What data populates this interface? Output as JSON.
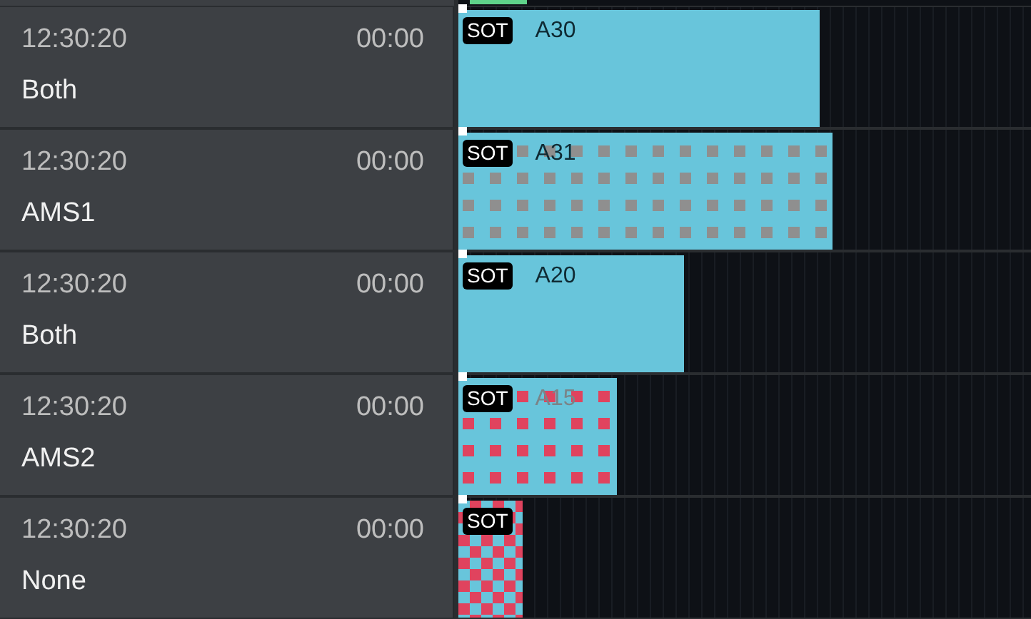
{
  "rows": [
    {
      "time": "12:30:20",
      "duration": "00:00",
      "mode": "Both",
      "clip": {
        "badge": "SOT",
        "label": "A30",
        "kind": "plain",
        "level": 0.63,
        "label_dimmed": false
      }
    },
    {
      "time": "12:30:20",
      "duration": "00:00",
      "mode": "AMS1",
      "clip": {
        "badge": "SOT",
        "label": "A31",
        "kind": "grey-squares",
        "level": 0.653,
        "label_dimmed": false
      }
    },
    {
      "time": "12:30:20",
      "duration": "00:00",
      "mode": "Both",
      "clip": {
        "badge": "SOT",
        "label": "A20",
        "kind": "plain",
        "level": 0.395,
        "label_dimmed": false
      }
    },
    {
      "time": "12:30:20",
      "duration": "00:00",
      "mode": "AMS2",
      "clip": {
        "badge": "SOT",
        "label": "A15",
        "kind": "red-squares",
        "level": 0.278,
        "label_dimmed": true
      }
    },
    {
      "time": "12:30:20",
      "duration": "00:00",
      "mode": "None",
      "clip": {
        "badge": "SOT",
        "kind": "red-checker",
        "level": 0.113
      }
    }
  ]
}
